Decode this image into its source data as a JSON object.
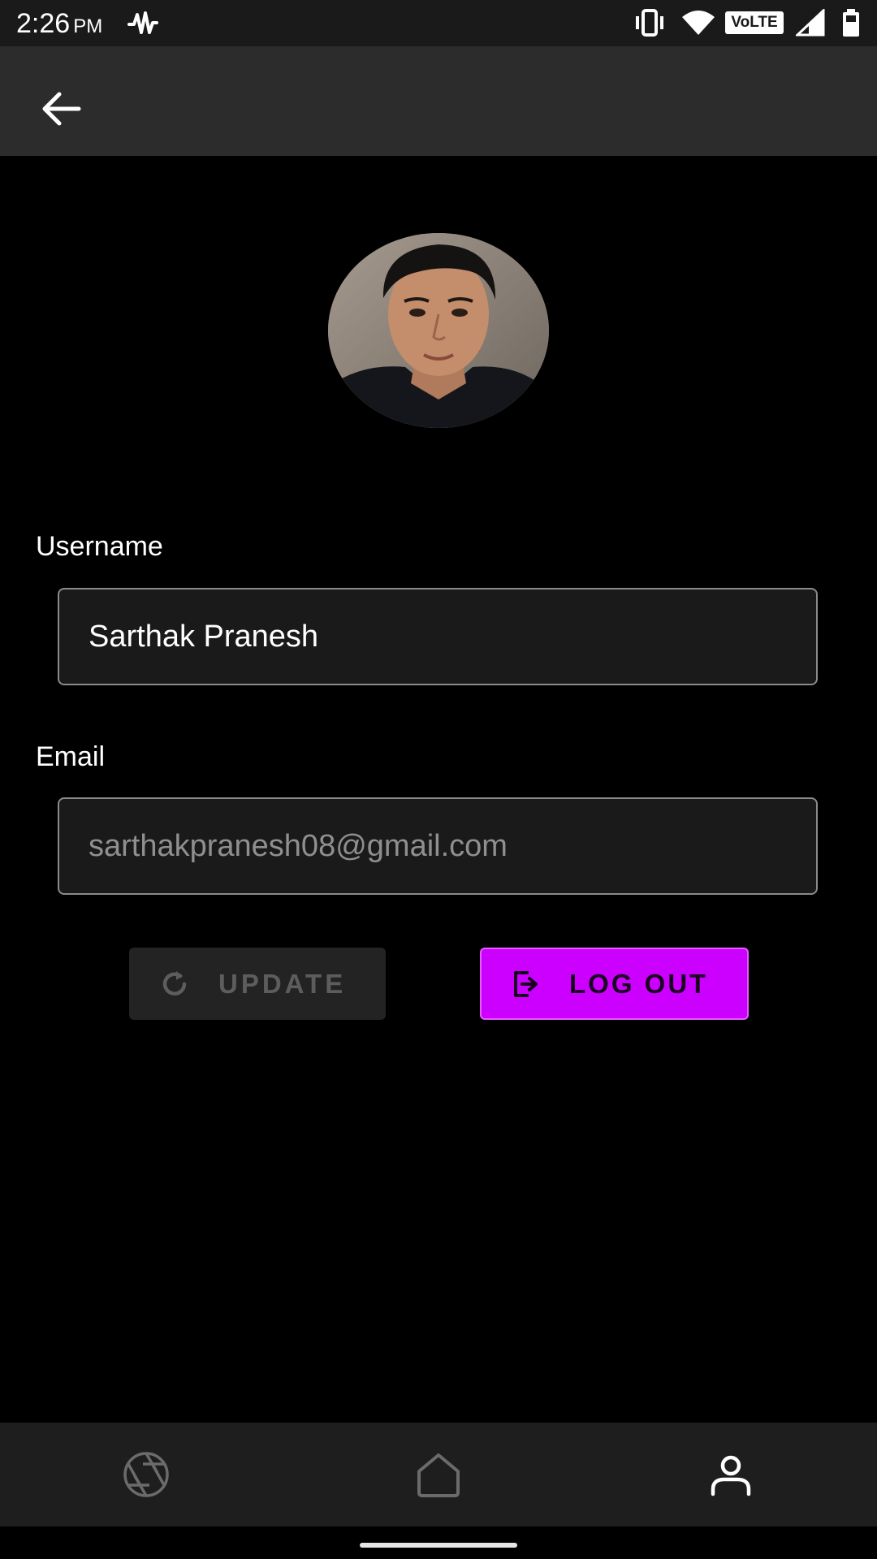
{
  "status_bar": {
    "time": "2:26",
    "ampm": "PM",
    "volte": "VoLTE",
    "icons": [
      "pulse-icon",
      "vibrate-icon",
      "wifi-icon",
      "volte-badge",
      "signal-icon",
      "battery-icon"
    ]
  },
  "app_bar": {
    "back_icon": "arrow-left-icon"
  },
  "profile": {
    "avatar": "avatar"
  },
  "form": {
    "username_label": "Username",
    "username_value": "Sarthak Pranesh",
    "email_label": "Email",
    "email_value": "sarthakpranesh08@gmail.com"
  },
  "actions": {
    "update_label": "UPDATE",
    "update_icon": "refresh-icon",
    "logout_label": "LOG OUT",
    "logout_icon": "logout-icon"
  },
  "bottom_nav": {
    "items": [
      {
        "icon": "aperture-icon",
        "active": false
      },
      {
        "icon": "home-icon",
        "active": false
      },
      {
        "icon": "user-icon",
        "active": true
      }
    ]
  },
  "colors": {
    "accent": "#cc00ff",
    "background": "#000000",
    "app_bar": "#2c2c2c",
    "field_bg": "#1a1a1a"
  }
}
